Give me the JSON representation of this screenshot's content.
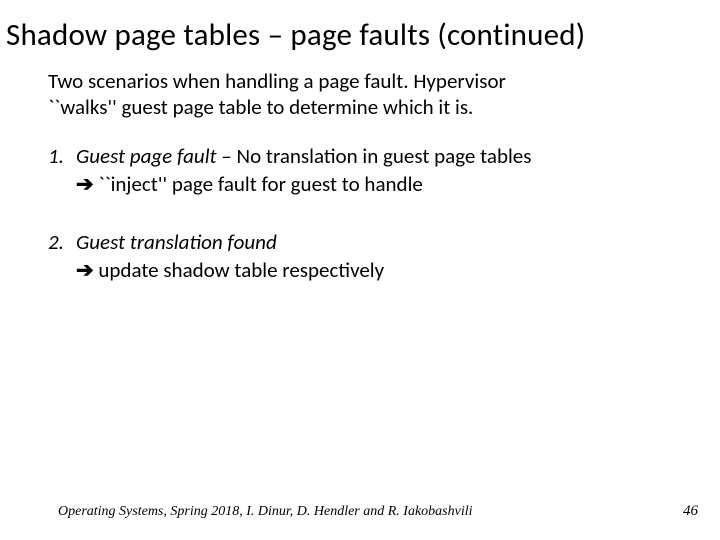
{
  "title": "Shadow page tables – page faults (continued)",
  "intro": "Two scenarios when handling a page fault. Hypervisor ``walks'' guest page table to determine which it is.",
  "items": [
    {
      "num": "1.",
      "lead": "Guest page fault",
      "dash": " – ",
      "rest": "No translation in guest page tables",
      "arrow": "➔",
      "cont_prefix": " ``inject'' ",
      "cont_rest": "page fault for guest to handle"
    },
    {
      "num": "2.",
      "lead": "Guest translation found",
      "dash": "",
      "rest": "",
      "arrow": "➔",
      "cont_prefix": " ",
      "cont_rest": "update shadow table respectively"
    }
  ],
  "footer_left": "Operating Systems, Spring 2018, I. Dinur, D. Hendler and R. Iakobashvili",
  "footer_right": "46"
}
